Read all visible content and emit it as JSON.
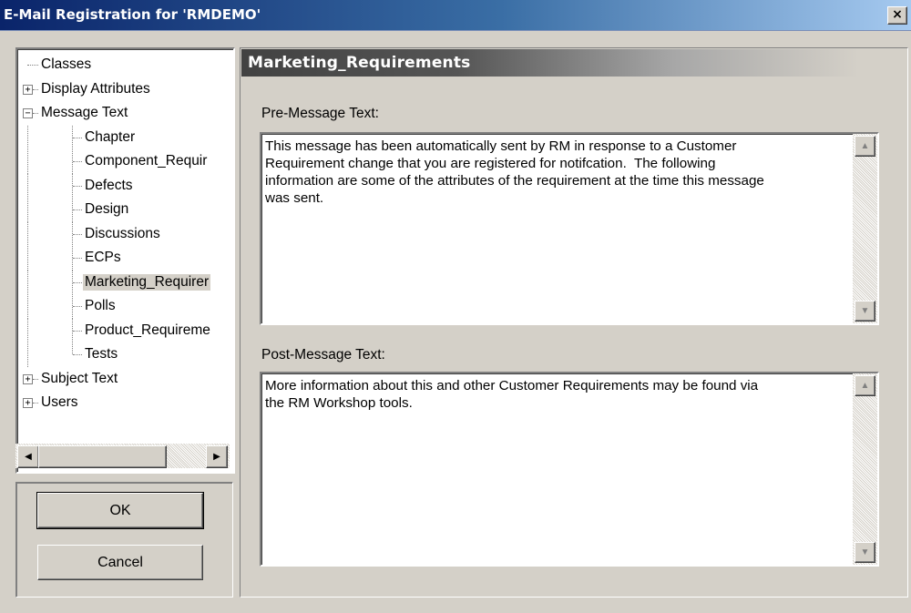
{
  "window": {
    "title": "E-Mail Registration for 'RMDEMO'",
    "close_label": "×"
  },
  "tree": {
    "items": [
      {
        "label": "Classes",
        "level": 0,
        "expander": ""
      },
      {
        "label": "Display Attributes",
        "level": 0,
        "expander": "+"
      },
      {
        "label": "Message Text",
        "level": 0,
        "expander": "−"
      },
      {
        "label": "Chapter",
        "level": 1,
        "expander": ""
      },
      {
        "label": "Component_Requir",
        "level": 1,
        "expander": ""
      },
      {
        "label": "Defects",
        "level": 1,
        "expander": ""
      },
      {
        "label": "Design",
        "level": 1,
        "expander": ""
      },
      {
        "label": "Discussions",
        "level": 1,
        "expander": ""
      },
      {
        "label": "ECPs",
        "level": 1,
        "expander": ""
      },
      {
        "label": "Marketing_Requirer",
        "level": 1,
        "expander": "",
        "selected": true
      },
      {
        "label": "Polls",
        "level": 1,
        "expander": ""
      },
      {
        "label": "Product_Requireme",
        "level": 1,
        "expander": ""
      },
      {
        "label": "Tests",
        "level": 1,
        "expander": ""
      },
      {
        "label": "Subject Text",
        "level": 0,
        "expander": "+"
      },
      {
        "label": "Users",
        "level": 0,
        "expander": "+"
      }
    ]
  },
  "buttons": {
    "ok": "OK",
    "cancel": "Cancel"
  },
  "panel": {
    "header": "Marketing_Requirements",
    "pre_label": "Pre-Message Text:",
    "pre_text": "This message has been automatically sent by RM in response to a Customer\nRequirement change that you are registered for notifcation.  The following\ninformation are some of the attributes of the requirement at the time this message\nwas sent.",
    "post_label": "Post-Message Text:",
    "post_text": "More information about this and other Customer Requirements may be found via\nthe RM Workshop tools."
  },
  "icons": {
    "scroll_up": "▲",
    "scroll_down": "▼",
    "scroll_left": "◀",
    "scroll_right": "▶"
  }
}
